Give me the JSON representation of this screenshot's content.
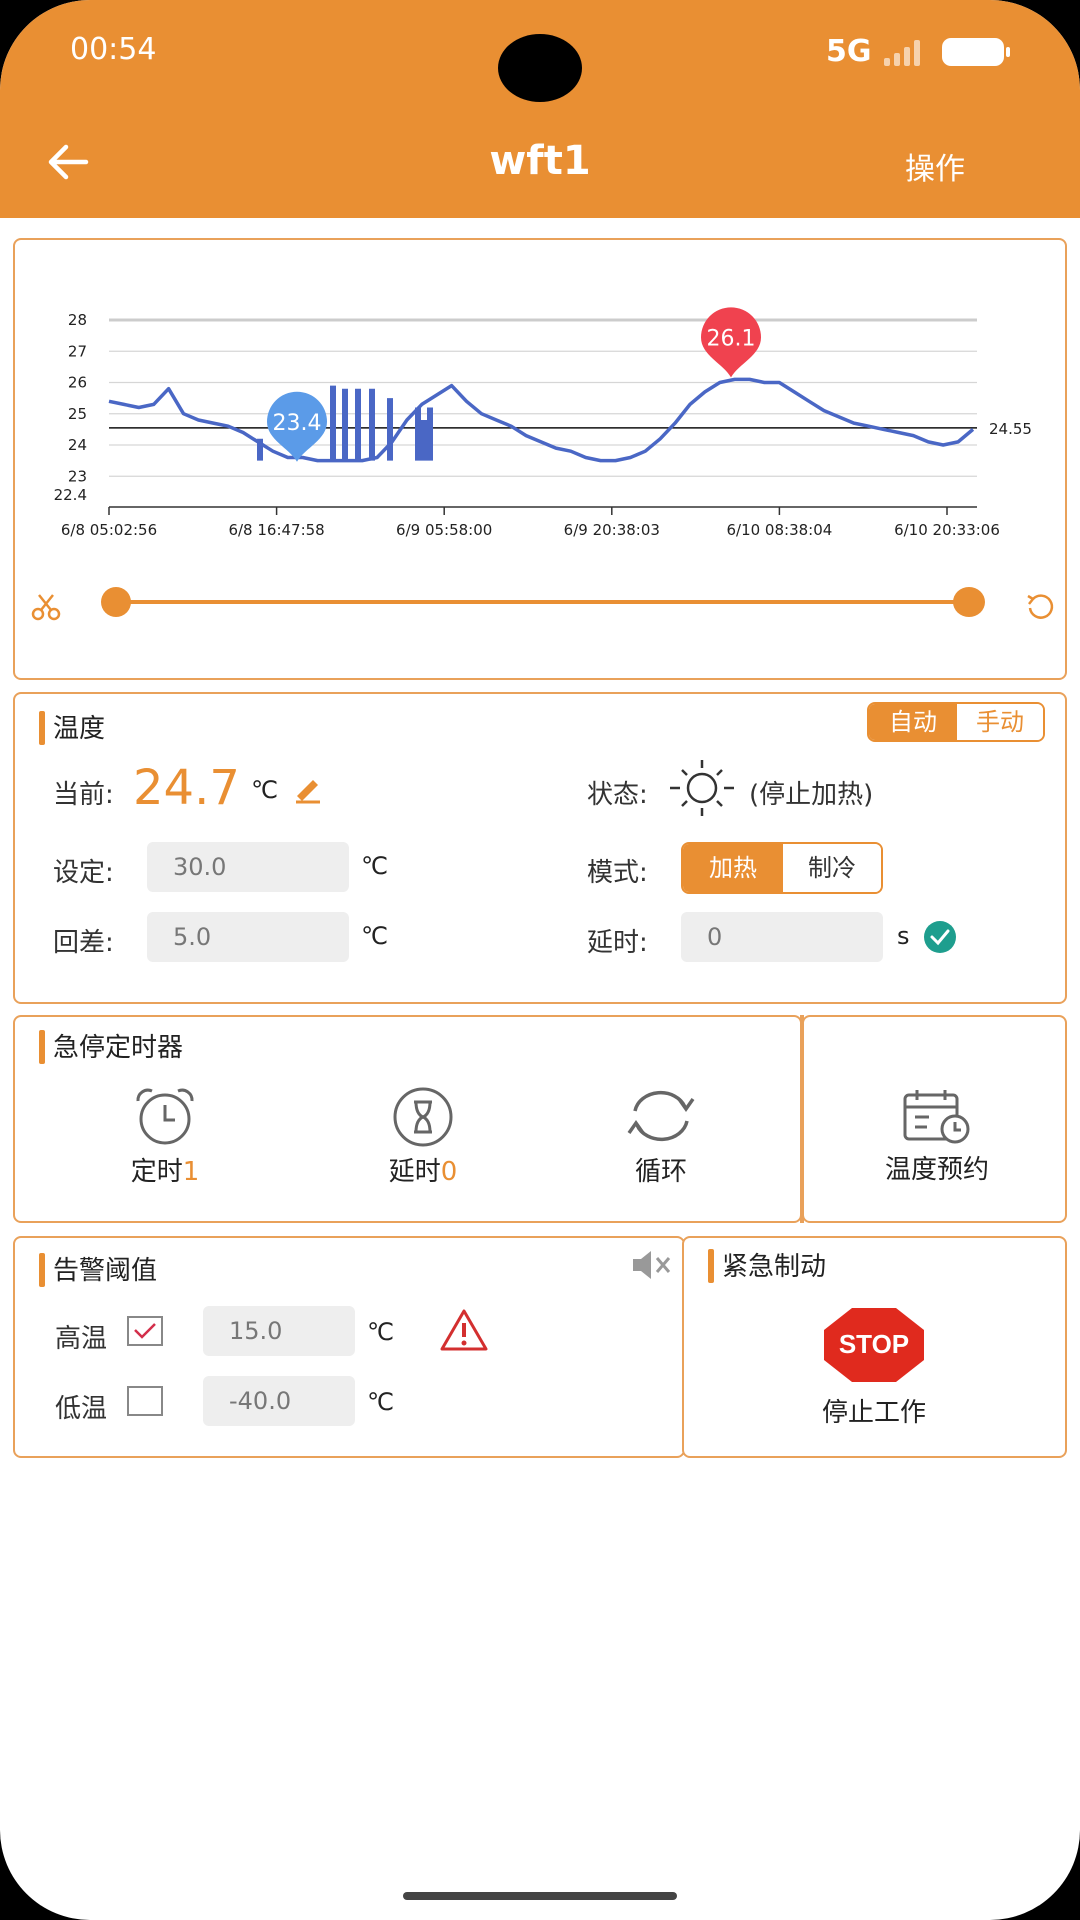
{
  "status_bar": {
    "time": "00:54",
    "network": "5G"
  },
  "header": {
    "title": "wft1",
    "action_label": "操作"
  },
  "chart_data": {
    "type": "line",
    "y_ticks": [
      "28",
      "27",
      "26",
      "25",
      "24",
      "23",
      "22.4"
    ],
    "x_ticks": [
      "6/8 05:02:56",
      "6/8 16:47:58",
      "6/9 05:58:00",
      "6/9 20:38:03",
      "6/10 08:38:04",
      "6/10 20:33:06"
    ],
    "ylim": [
      22.4,
      28
    ],
    "reference_line": {
      "value": "24.55"
    },
    "min_marker": {
      "value": "23.4"
    },
    "max_marker": {
      "value": "26.1"
    },
    "series": [
      {
        "color": "#4A67C5",
        "y": [
          25.4,
          25.3,
          25.2,
          25.3,
          25.8,
          25.0,
          24.8,
          24.7,
          24.6,
          24.4,
          24.1,
          23.8,
          23.6,
          23.6,
          23.5,
          23.5,
          23.5,
          23.5,
          23.6,
          24.1,
          24.8,
          25.3,
          25.6,
          25.9,
          25.4,
          25.0,
          24.8,
          24.6,
          24.3,
          24.1,
          23.9,
          23.8,
          23.6,
          23.5,
          23.5,
          23.6,
          23.8,
          24.2,
          24.7,
          25.3,
          25.7,
          26.0,
          26.1,
          26.1,
          26.0,
          26.0,
          25.7,
          25.4,
          25.1,
          24.9,
          24.7,
          24.6,
          24.5,
          24.4,
          24.3,
          24.1,
          24.0,
          24.1,
          24.5
        ]
      }
    ],
    "grid": true
  },
  "temperature": {
    "title": "温度",
    "mode_auto": "自动",
    "mode_manual": "手动",
    "current_label": "当前:",
    "current_value": "24.7",
    "unit": "℃",
    "set_label": "设定:",
    "set_value": "30.0",
    "diff_label": "回差:",
    "diff_value": "5.0",
    "state_label": "状态:",
    "state_value": "(停止加热)",
    "mode_label": "模式:",
    "heat": "加热",
    "cool": "制冷",
    "delay_label": "延时:",
    "delay_value": "0",
    "delay_unit": "s"
  },
  "timer": {
    "title": "急停定时器",
    "timing_label": "定时",
    "timing_count": "1",
    "delay_label": "延时",
    "delay_count": "0",
    "cycle_label": "循环",
    "schedule_label": "温度预约"
  },
  "alarm": {
    "title": "告警阈值",
    "high_label": "高温",
    "high_value": "15.0",
    "low_label": "低温",
    "low_value": "-40.0",
    "unit": "℃"
  },
  "emergency": {
    "title": "紧急制动",
    "stop_sign": "STOP",
    "stop_label": "停止工作"
  }
}
